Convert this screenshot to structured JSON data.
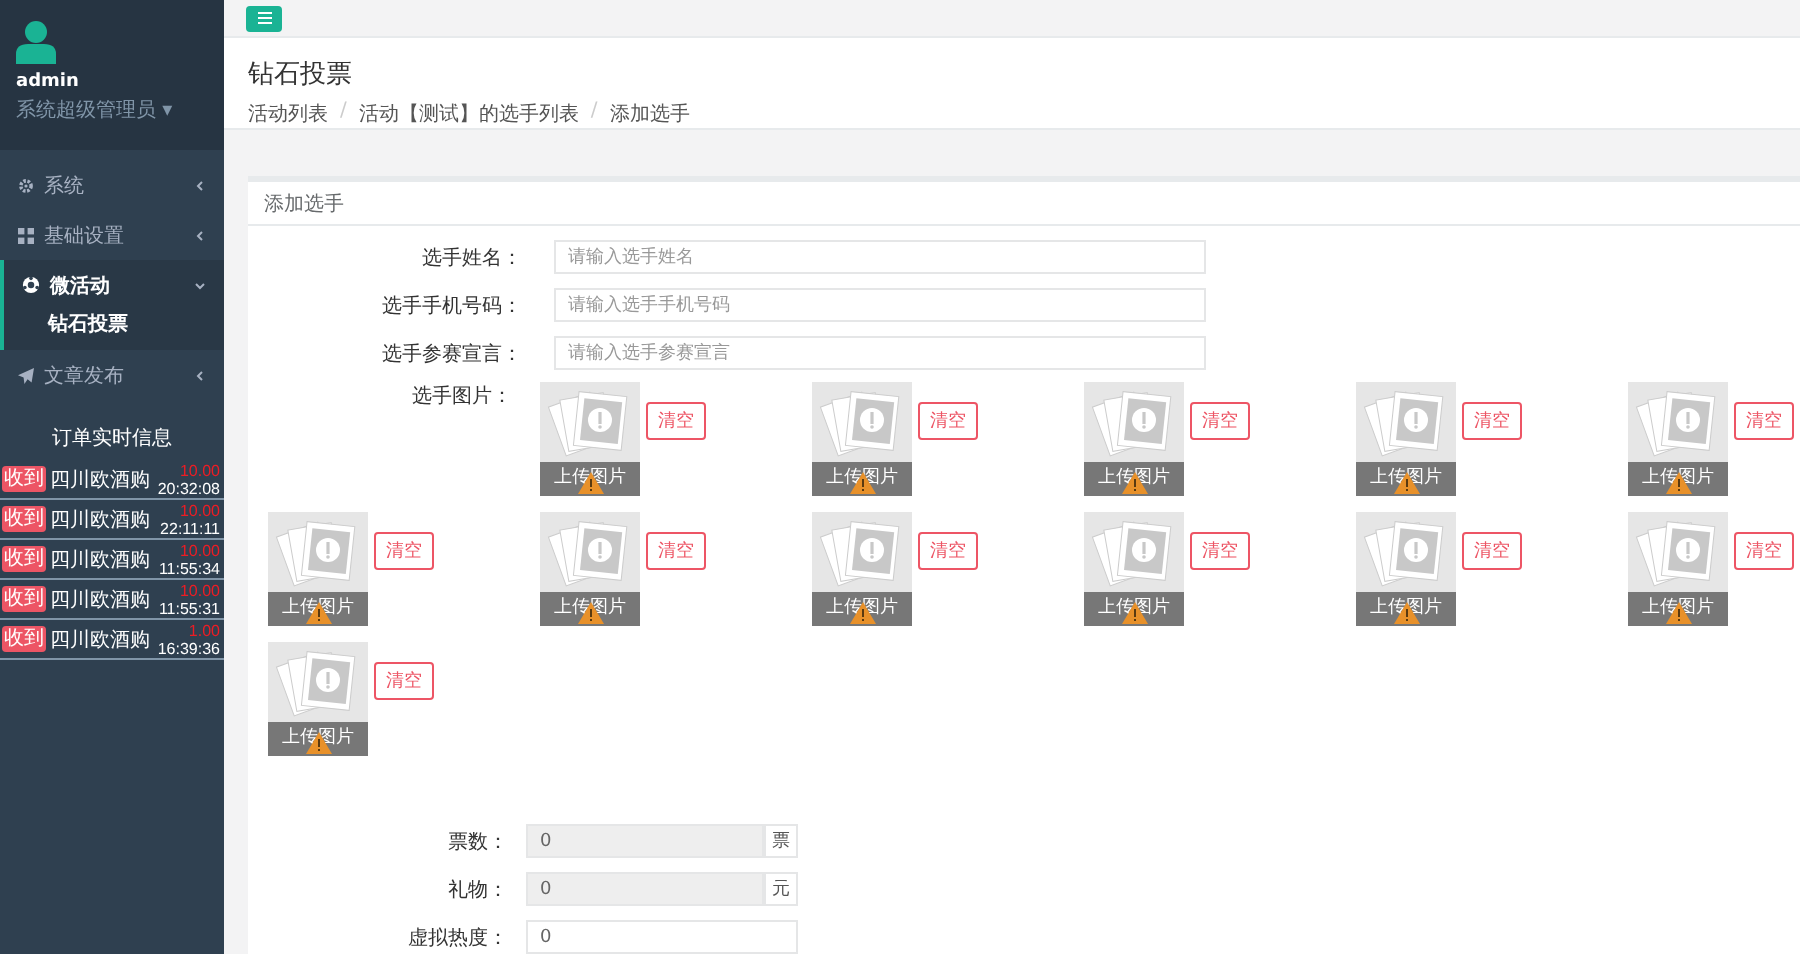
{
  "sidebar": {
    "user": {
      "name": "admin",
      "role": "系统超级管理员 ▾"
    },
    "menu": [
      {
        "label": "系统",
        "expanded": false
      },
      {
        "label": "基础设置",
        "expanded": false
      },
      {
        "label": "微活动",
        "expanded": true,
        "children": [
          {
            "label": "钻石投票",
            "selected": true
          }
        ]
      },
      {
        "label": "文章发布",
        "expanded": false
      }
    ],
    "orders_title": "订单实时信息",
    "orders": [
      {
        "badge": "收到",
        "name": "四川欧酒购",
        "amount": "10.00",
        "time": "20:32:08"
      },
      {
        "badge": "收到",
        "name": "四川欧酒购",
        "amount": "10.00",
        "time": "22:11:11"
      },
      {
        "badge": "收到",
        "name": "四川欧酒购",
        "amount": "10.00",
        "time": "11:55:34"
      },
      {
        "badge": "收到",
        "name": "四川欧酒购",
        "amount": "10.00",
        "time": "11:55:31"
      },
      {
        "badge": "收到",
        "name": "四川欧酒购",
        "amount": "1.00",
        "time": "16:39:36"
      }
    ]
  },
  "header": {
    "title": "钻石投票",
    "breadcrumb": [
      "活动列表",
      "活动【测试】的选手列表",
      "添加选手"
    ],
    "separator": "/"
  },
  "form": {
    "title": "添加选手",
    "fields": [
      {
        "label": "选手姓名：",
        "placeholder": "请输入选手姓名"
      },
      {
        "label": "选手手机号码：",
        "placeholder": "请输入选手手机号码"
      },
      {
        "label": "选手参赛宣言：",
        "placeholder": "请输入选手参赛宣言"
      }
    ],
    "images_label": "选手图片：",
    "images": [
      {
        "caption": "上传图片",
        "button": "清空"
      },
      {
        "caption": "上传图片",
        "button": "清空"
      },
      {
        "caption": "上传图片",
        "button": "清空"
      },
      {
        "caption": "上传图片",
        "button": "清空"
      },
      {
        "caption": "上传图片",
        "button": "清空"
      },
      {
        "caption": "上传图片",
        "button": "清空"
      },
      {
        "caption": "上传图片",
        "button": "清空"
      },
      {
        "caption": "上传图片",
        "button": "清空"
      },
      {
        "caption": "上传图片",
        "button": "清空"
      },
      {
        "caption": "上传图片",
        "button": "清空"
      },
      {
        "caption": "上传图片",
        "button": "清空"
      },
      {
        "caption": "上传图片",
        "button": "清空"
      }
    ],
    "addon_fields": [
      {
        "label": "票数：",
        "value": "0",
        "addon": "票"
      },
      {
        "label": "礼物：",
        "value": "0",
        "addon": "元"
      },
      {
        "label": "虚拟热度：",
        "value": "0"
      }
    ]
  }
}
